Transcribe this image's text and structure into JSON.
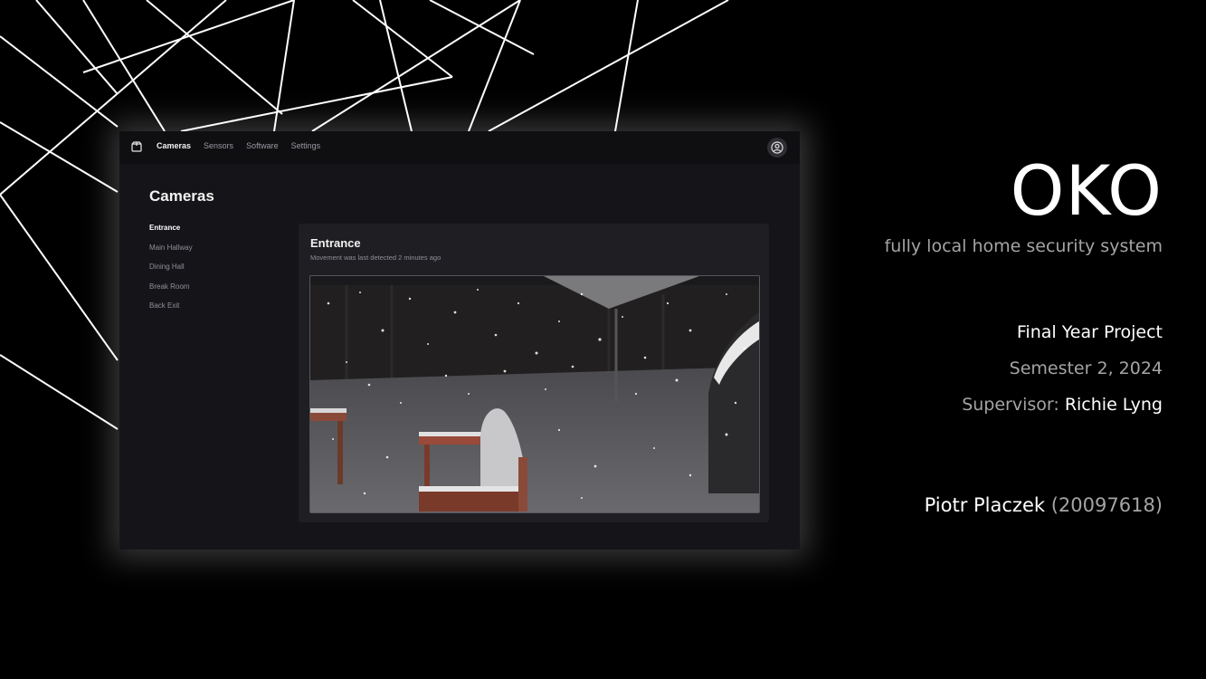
{
  "app": {
    "nav": [
      "Cameras",
      "Sensors",
      "Software",
      "Settings"
    ],
    "page_title": "Cameras",
    "camera_list": [
      "Entrance",
      "Main Hallway",
      "Dining Hall",
      "Break Room",
      "Back Exit"
    ],
    "card": {
      "title": "Entrance",
      "subtitle": "Movement was last detected 2 minutes ago"
    }
  },
  "slide": {
    "title": "OKO",
    "subtitle": "fully local home security system",
    "project": "Final Year Project",
    "semester": "Semester 2, 2024",
    "supervisor_label": "Supervisor:",
    "supervisor_name": "Richie Lyng",
    "author_name": "Piotr Placzek",
    "author_id": "(20097618)"
  },
  "colors": {
    "background": "#000000",
    "app_surface": "#151519",
    "card_surface": "#1e1e23",
    "muted_text": "#a4a4a4"
  },
  "icons": [
    "box-logo-icon",
    "user-circle-icon"
  ]
}
